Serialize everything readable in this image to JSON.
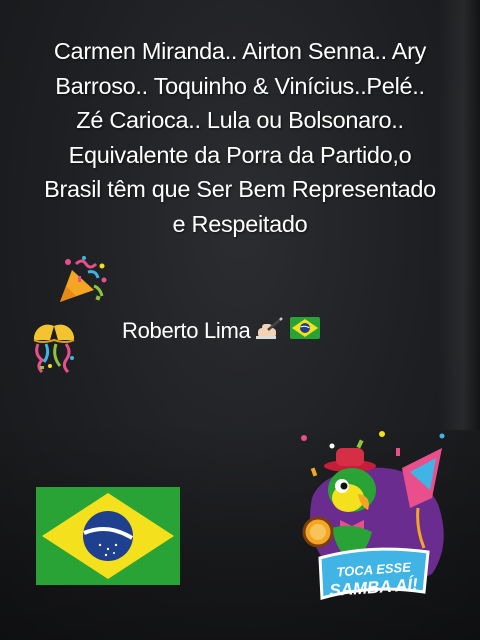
{
  "message": {
    "lines": [
      "Carmen Miranda.. Airton Senna.. Ary",
      "Barroso.. Toquinho & Vinícius..Pelé..",
      "Zé Carioca.. Lula ou Bolsonaro..",
      "Equivalente da Porra da Partido,o",
      "Brasil têm que Ser Bem Representado",
      "e  Respeitado"
    ]
  },
  "signature": {
    "name": "Roberto Lima",
    "icons": [
      "writing-hand-icon",
      "brazil-flag-icon"
    ]
  },
  "decorations": [
    "party-popper-icon",
    "confetti-ball-icon",
    "brazil-flag",
    "toca-esse-samba-sticker"
  ],
  "sticker": {
    "line1": "TOCA ESSE",
    "line2": "SAMBA AÍ!"
  },
  "colors": {
    "flag_green": "#2aa336",
    "flag_yellow": "#f4e01c",
    "flag_blue": "#1f3f8f"
  }
}
